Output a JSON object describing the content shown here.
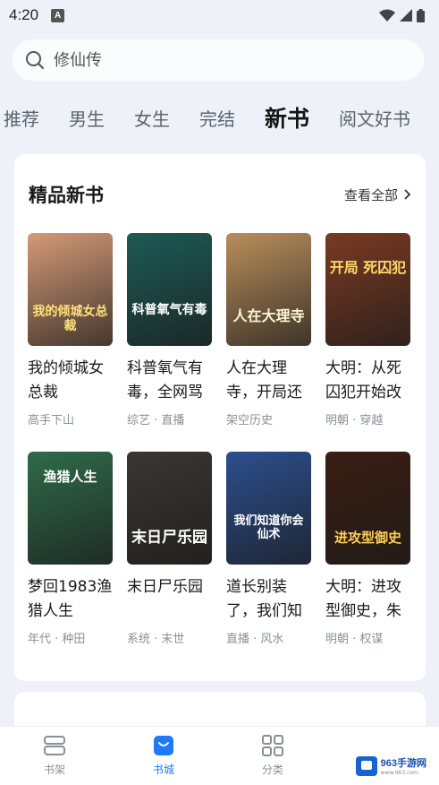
{
  "status": {
    "time": "4:20",
    "badge": "A"
  },
  "search": {
    "placeholder": "修仙传"
  },
  "tabs": [
    "推荐",
    "男生",
    "女生",
    "完结",
    "新书",
    "阅文好书"
  ],
  "active_tab": "新书",
  "section": {
    "title": "精品新书",
    "see_all": "查看全部"
  },
  "books": [
    {
      "title": "我的倾城女总裁",
      "tags": "高手下山",
      "cover_text": "我的倾城女总裁",
      "cover_bg": "#d49a77"
    },
    {
      "title": "科普氧气有毒，全网骂",
      "tags": "综艺 · 直播",
      "cover_text": "科普氧气有毒",
      "cover_bg": "#1d5a55"
    },
    {
      "title": "人在大理寺，开局还",
      "tags": "架空历史",
      "cover_text": "人在大理寺",
      "cover_bg": "#b98e5c"
    },
    {
      "title": "大明：从死囚犯开始改",
      "tags": "明朝 · 穿越",
      "cover_text": "开局 死囚犯",
      "cover_bg": "#7a3a22"
    },
    {
      "title": "梦回1983渔猎人生",
      "tags": "年代 · 种田",
      "cover_text": "渔猎人生",
      "cover_bg": "#2f6b4a"
    },
    {
      "title": "末日尸乐园",
      "tags": "系统 · 末世",
      "cover_text": "末日尸乐园",
      "cover_bg": "#3a3634"
    },
    {
      "title": "道长别装了，我们知",
      "tags": "直播 · 风水",
      "cover_text": "我们知道你会仙术",
      "cover_bg": "#2c4f8e"
    },
    {
      "title": "大明：进攻型御史，朱",
      "tags": "明朝 · 权谋",
      "cover_text": "进攻型御史",
      "cover_bg": "#3a1e12"
    }
  ],
  "nav": [
    {
      "label": "书架",
      "icon": "bookshelf-icon"
    },
    {
      "label": "书城",
      "icon": "bookstore-icon"
    },
    {
      "label": "分类",
      "icon": "category-icon"
    }
  ],
  "watermark": {
    "text": "963手游网",
    "sub": "www.963.com"
  },
  "colors": {
    "accent": "#1f7af5",
    "bg": "#eef2f8"
  }
}
